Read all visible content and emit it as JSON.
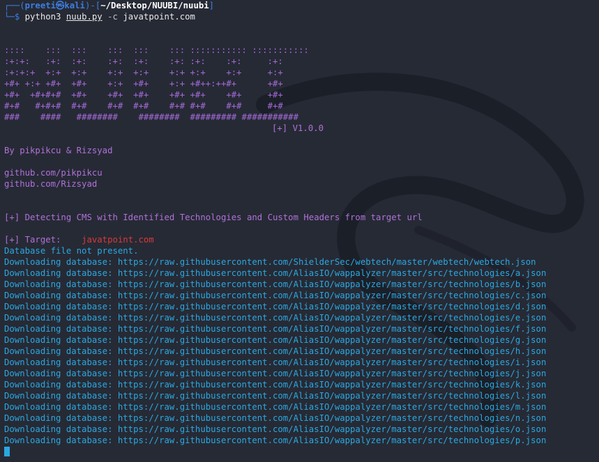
{
  "prompt": {
    "corner_top": "┌──(",
    "user": "preeti㉿kali",
    "bracket_mid": ")-[",
    "path": "~/Desktop/NUUBI/nuubi",
    "bracket_end": "]",
    "corner_bottom": "└─",
    "dollar": "$ ",
    "cmd_python": "python3 ",
    "cmd_script": "nuub.py",
    "cmd_flag": " -c ",
    "cmd_arg": "javatpoint.com"
  },
  "banner": {
    "lines": [
      "::::    :::  :::    :::  :::    ::: ::::::::::: :::::::::::",
      ":+:+:   :+:  :+:    :+:  :+:    :+: :+:    :+:     :+:",
      ":+:+:+  +:+  +:+    +:+  +:+    +:+ +:+    +:+     +:+",
      "+#+ +:+ +#+  +#+    +:+  +#+    +:+ +#++:++#+      +#+",
      "+#+  +#+#+#  +#+    +#+  +#+    +#+ +#+    +#+     +#+",
      "#+#   #+#+#  #+#    #+#  #+#    #+# #+#    #+#     #+#",
      "###    ####   ########    ########  ######### ###########"
    ],
    "version": "[+] V1.0.0"
  },
  "credits": {
    "by": "By pikpikcu & Rizsyad",
    "github1": "github.com/pikpikcu",
    "github2": "github.com/Rizsyad"
  },
  "output": {
    "detecting": "[+] Detecting CMS with Identified Technologies and Custom Headers from target url",
    "target_label": "[+] Target:",
    "target_value": "javatpoint.com",
    "db_missing": "Database file not present.",
    "downloads": [
      "Downloading database: https://raw.githubusercontent.com/ShielderSec/webtech/master/webtech/webtech.json",
      "Downloading database: https://raw.githubusercontent.com/AliasIO/wappalyzer/master/src/technologies/a.json",
      "Downloading database: https://raw.githubusercontent.com/AliasIO/wappalyzer/master/src/technologies/b.json",
      "Downloading database: https://raw.githubusercontent.com/AliasIO/wappalyzer/master/src/technologies/c.json",
      "Downloading database: https://raw.githubusercontent.com/AliasIO/wappalyzer/master/src/technologies/d.json",
      "Downloading database: https://raw.githubusercontent.com/AliasIO/wappalyzer/master/src/technologies/e.json",
      "Downloading database: https://raw.githubusercontent.com/AliasIO/wappalyzer/master/src/technologies/f.json",
      "Downloading database: https://raw.githubusercontent.com/AliasIO/wappalyzer/master/src/technologies/g.json",
      "Downloading database: https://raw.githubusercontent.com/AliasIO/wappalyzer/master/src/technologies/h.json",
      "Downloading database: https://raw.githubusercontent.com/AliasIO/wappalyzer/master/src/technologies/i.json",
      "Downloading database: https://raw.githubusercontent.com/AliasIO/wappalyzer/master/src/technologies/j.json",
      "Downloading database: https://raw.githubusercontent.com/AliasIO/wappalyzer/master/src/technologies/k.json",
      "Downloading database: https://raw.githubusercontent.com/AliasIO/wappalyzer/master/src/technologies/l.json",
      "Downloading database: https://raw.githubusercontent.com/AliasIO/wappalyzer/master/src/technologies/m.json",
      "Downloading database: https://raw.githubusercontent.com/AliasIO/wappalyzer/master/src/technologies/n.json",
      "Downloading database: https://raw.githubusercontent.com/AliasIO/wappalyzer/master/src/technologies/o.json",
      "Downloading database: https://raw.githubusercontent.com/AliasIO/wappalyzer/master/src/technologies/p.json"
    ]
  },
  "colors": {
    "background": "#262a35",
    "prompt_blue": "#3d7ee0",
    "banner_purple": "#a46ad8",
    "target_red": "#d83a3a",
    "output_blue": "#2aa8e0"
  }
}
